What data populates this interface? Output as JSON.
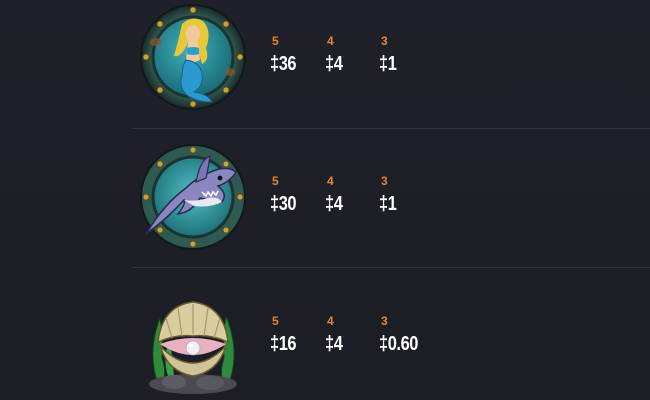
{
  "paytable": {
    "rows": [
      {
        "symbol": "mermaid-porthole-symbol",
        "payouts": [
          {
            "count": "5",
            "amount": "‡36"
          },
          {
            "count": "4",
            "amount": "‡4"
          },
          {
            "count": "3",
            "amount": "‡1"
          }
        ]
      },
      {
        "symbol": "shark-porthole-symbol",
        "payouts": [
          {
            "count": "5",
            "amount": "‡30"
          },
          {
            "count": "4",
            "amount": "‡4"
          },
          {
            "count": "3",
            "amount": "‡1"
          }
        ]
      },
      {
        "symbol": "clam-pearl-symbol",
        "payouts": [
          {
            "count": "5",
            "amount": "‡16"
          },
          {
            "count": "4",
            "amount": "‡4"
          },
          {
            "count": "3",
            "amount": "‡0.60"
          }
        ]
      }
    ]
  },
  "colors": {
    "background": "#1e1f27",
    "count_accent": "#e8842c",
    "amount_text": "#ffffff",
    "divider": "#34353f"
  }
}
